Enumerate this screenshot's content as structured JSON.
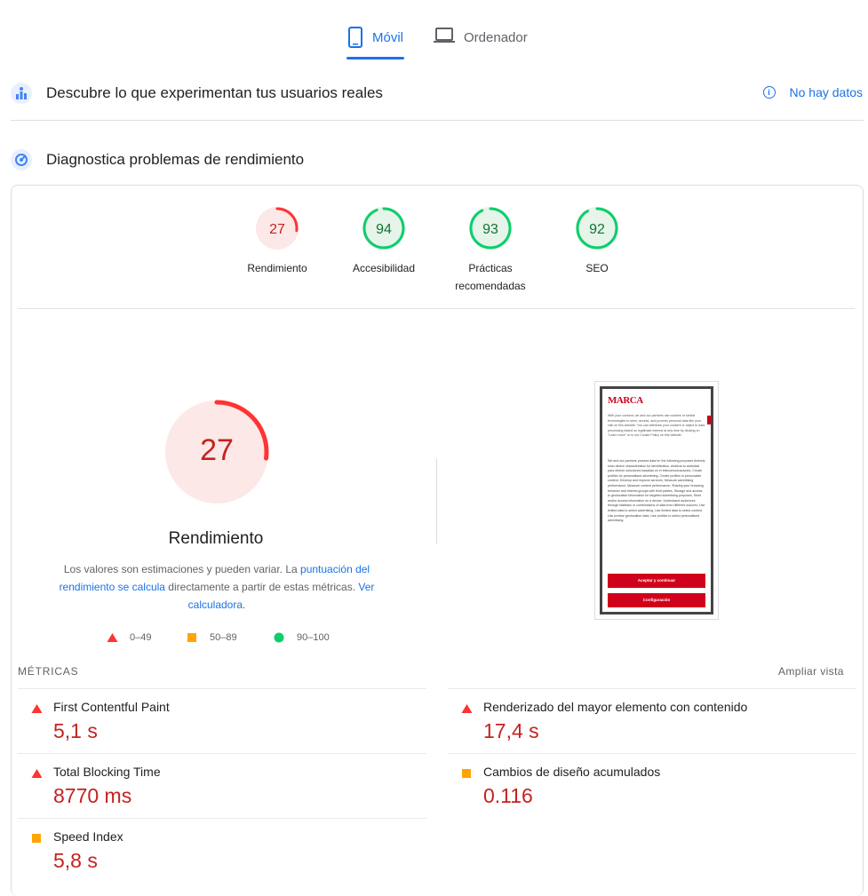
{
  "tabs": [
    {
      "label": "Móvil",
      "icon": "mobile-icon",
      "active": true
    },
    {
      "label": "Ordenador",
      "icon": "laptop-icon",
      "active": false
    }
  ],
  "field_data": {
    "title": "Descubre lo que experimentan tus usuarios reales",
    "status": "No hay datos"
  },
  "lab_data": {
    "title": "Diagnostica problemas de rendimiento"
  },
  "categories": [
    {
      "label": "Rendimiento",
      "score": 27,
      "color": "#ff3333"
    },
    {
      "label": "Accesibilidad",
      "score": 94,
      "color": "#0cce6b"
    },
    {
      "label": "Prácticas recomendadas",
      "score": 93,
      "color": "#0cce6b"
    },
    {
      "label": "SEO",
      "score": 92,
      "color": "#0cce6b"
    }
  ],
  "performance": {
    "score": "27",
    "score_value": 27,
    "title": "Rendimiento",
    "desc_pre": "Los valores son estimaciones y pueden variar. La ",
    "desc_link1": "puntuación del rendimiento se calcula",
    "desc_mid": " directamente a partir de estas métricas. ",
    "desc_link2": "Ver calculadora",
    "desc_end": "."
  },
  "legend": [
    {
      "range": "0–49",
      "color": "#ff3333",
      "shape": "triangle"
    },
    {
      "range": "50–89",
      "color": "#ffa400",
      "shape": "square"
    },
    {
      "range": "90–100",
      "color": "#0cce6b",
      "shape": "circle"
    }
  ],
  "screenshot": {
    "brand": "MARCA",
    "body_text": "With your consent, we and our partners use cookies or similar technologies to store, access, and process personal data like your visit on this website. You can withdraw your consent or object to data processing based on legitimate interest at any time by clicking on \"Learn more\" or in our Cookie Policy on this website.",
    "purposes_text": "We and our partners process data for the following purposes Actively scan device characteristics for identification, Analizar tu actividad para ofrecer soluciones basadas en el telecomunicaciones, Create profiles for personalised advertising, Create profiles to personalise content, Develop and improve services, Measure advertising performance, Measure content performance, Sharing your browsing behavior and interest groups with third parties, Storage and access to geolocation information for targeted advertising purposes, Store and/or access information on a device, Understand audiences through statistics or combinations of data from different sources, Use limited data to select advertising, Use limited data to select content, Use precise geolocation data, Use profiles to select personalised advertising.",
    "accept_btn": "Aceptar y continuar",
    "config_btn": "Configuración"
  },
  "metrics": {
    "header": "MÉTRICAS",
    "expand": "Ampliar vista",
    "items": [
      {
        "name": "First Contentful Paint",
        "value": "5,1 s",
        "status": "fail"
      },
      {
        "name": "Renderizado del mayor elemento con contenido",
        "value": "17,4 s",
        "status": "fail"
      },
      {
        "name": "Total Blocking Time",
        "value": "8770 ms",
        "status": "fail"
      },
      {
        "name": "Cambios de diseño acumulados",
        "value": "0.116",
        "status": "average"
      },
      {
        "name": "Speed Index",
        "value": "5,8 s",
        "status": "average"
      }
    ]
  },
  "colors": {
    "accent": "#1a73e8",
    "fail": "#ff3333",
    "average": "#ffa400",
    "pass": "#0cce6b"
  }
}
